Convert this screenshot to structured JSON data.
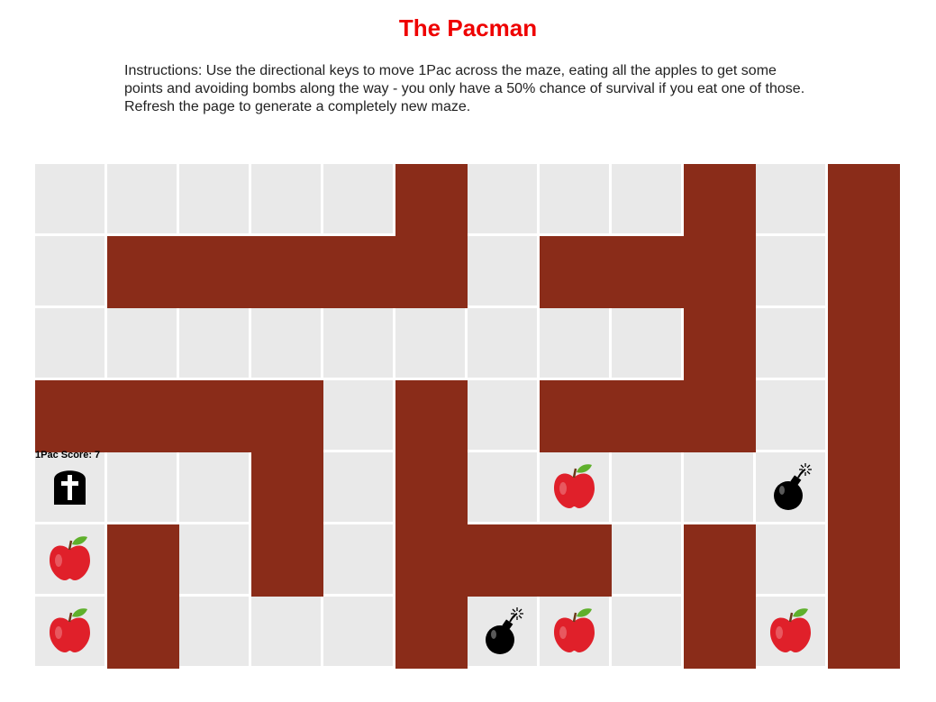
{
  "title": "The Pacman",
  "instructions": "Instructions: Use the directional keys to move 1Pac across the maze, eating all the apples to get some points and avoiding bombs along the way - you only have a 50% chance of survival if you eat one of those. Refresh the page to generate a completely new maze.",
  "colors": {
    "title": "#ee0000",
    "floor": "#e9e9e9",
    "brick": "#8a2c19",
    "mortar": "#ffffff",
    "apple": "#e0202a",
    "leaf": "#5fb02c",
    "bomb": "#000000"
  },
  "player": {
    "name": "1Pac",
    "score_label": "1Pac Score: 7",
    "score": 7,
    "state": "dead",
    "icon": "tombstone-icon"
  },
  "maze": {
    "legend": {
      "0": "floor",
      "1": "brick-wall",
      "A": "apple",
      "B": "bomb",
      "P": "player-tombstone"
    },
    "grid": [
      [
        "0",
        "0",
        "0",
        "0",
        "0",
        "1",
        "0",
        "0",
        "0",
        "1",
        "0",
        "1"
      ],
      [
        "0",
        "1",
        "1",
        "1",
        "1",
        "1",
        "0",
        "1",
        "1",
        "1",
        "0",
        "1"
      ],
      [
        "0",
        "0",
        "0",
        "0",
        "0",
        "0",
        "0",
        "0",
        "0",
        "1",
        "0",
        "1"
      ],
      [
        "1",
        "1",
        "1",
        "1",
        "0",
        "1",
        "0",
        "1",
        "1",
        "1",
        "0",
        "1"
      ],
      [
        "P",
        "0",
        "0",
        "1",
        "0",
        "1",
        "0",
        "A",
        "0",
        "0",
        "B",
        "1"
      ],
      [
        "A",
        "1",
        "0",
        "1",
        "0",
        "1",
        "1",
        "1",
        "0",
        "1",
        "0",
        "1"
      ],
      [
        "A",
        "1",
        "0",
        "0",
        "0",
        "1",
        "B",
        "A",
        "0",
        "1",
        "A",
        "1"
      ]
    ]
  }
}
